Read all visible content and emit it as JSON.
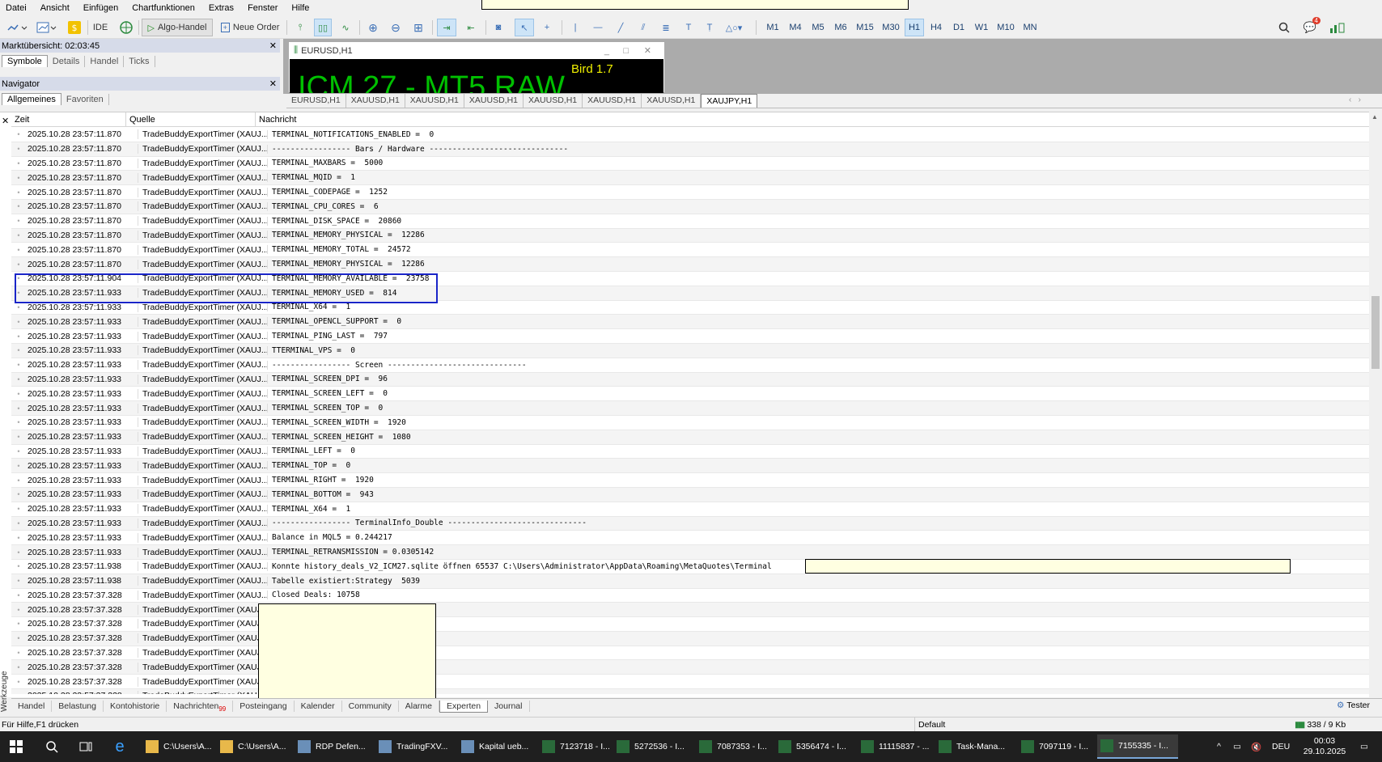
{
  "menu": [
    "Datei",
    "Ansicht",
    "Einfügen",
    "Chartfunktionen",
    "Extras",
    "Fenster",
    "Hilfe"
  ],
  "toolbar": {
    "ide_label": "IDE",
    "algo_label": "Algo-Handel",
    "order_label": "Neue Order",
    "timeframes": [
      "M1",
      "M4",
      "M5",
      "M6",
      "M15",
      "M30",
      "H1",
      "H4",
      "D1",
      "W1",
      "M10",
      "MN"
    ],
    "active_timeframe": "H1",
    "notification_count": "4"
  },
  "market_watch": {
    "title": "Marktübersicht: 02:03:45",
    "tabs": [
      "Symbole",
      "Details",
      "Handel",
      "Ticks"
    ]
  },
  "navigator": {
    "title": "Navigator",
    "tabs": [
      "Allgemeines",
      "Favoriten"
    ]
  },
  "chart_window": {
    "title": "EURUSD,H1",
    "big_text": "ICM 27 - MT5 RAW",
    "overlay_text": "Bird 1.7"
  },
  "chart_tabs": [
    "EURUSD,H1",
    "XAUUSD,H1",
    "XAUUSD,H1",
    "XAUUSD,H1",
    "XAUUSD,H1",
    "XAUUSD,H1",
    "XAUUSD,H1",
    "XAUJPY,H1"
  ],
  "log": {
    "columns": [
      "Zeit",
      "Quelle",
      "Nachricht"
    ],
    "rows": [
      {
        "time": "2025.10.28 23:57:11.870",
        "source": "TradeBuddyExportTimer (XAUJ...",
        "msg": "TERMINAL_NOTIFICATIONS_ENABLED =  0"
      },
      {
        "time": "2025.10.28 23:57:11.870",
        "source": "TradeBuddyExportTimer (XAUJ...",
        "msg": "----------------- Bars / Hardware ------------------------------"
      },
      {
        "time": "2025.10.28 23:57:11.870",
        "source": "TradeBuddyExportTimer (XAUJ...",
        "msg": "TERMINAL_MAXBARS =  5000"
      },
      {
        "time": "2025.10.28 23:57:11.870",
        "source": "TradeBuddyExportTimer (XAUJ...",
        "msg": "TERMINAL_MQID =  1"
      },
      {
        "time": "2025.10.28 23:57:11.870",
        "source": "TradeBuddyExportTimer (XAUJ...",
        "msg": "TERMINAL_CODEPAGE =  1252"
      },
      {
        "time": "2025.10.28 23:57:11.870",
        "source": "TradeBuddyExportTimer (XAUJ...",
        "msg": "TERMINAL_CPU_CORES =  6"
      },
      {
        "time": "2025.10.28 23:57:11.870",
        "source": "TradeBuddyExportTimer (XAUJ...",
        "msg": "TERMINAL_DISK_SPACE =  20860"
      },
      {
        "time": "2025.10.28 23:57:11.870",
        "source": "TradeBuddyExportTimer (XAUJ...",
        "msg": "TERMINAL_MEMORY_PHYSICAL =  12286"
      },
      {
        "time": "2025.10.28 23:57:11.870",
        "source": "TradeBuddyExportTimer (XAUJ...",
        "msg": "TERMINAL_MEMORY_TOTAL =  24572"
      },
      {
        "time": "2025.10.28 23:57:11.870",
        "source": "TradeBuddyExportTimer (XAUJ...",
        "msg": "TERMINAL_MEMORY_PHYSICAL =  12286"
      },
      {
        "time": "2025.10.28 23:57:11.904",
        "source": "TradeBuddyExportTimer (XAUJ...",
        "msg": "TERMINAL_MEMORY_AVAILABLE =  23758"
      },
      {
        "time": "2025.10.28 23:57:11.933",
        "source": "TradeBuddyExportTimer (XAUJ...",
        "msg": "TERMINAL_MEMORY_USED =  814"
      },
      {
        "time": "2025.10.28 23:57:11.933",
        "source": "TradeBuddyExportTimer (XAUJ...",
        "msg": "TERMINAL_X64 =  1"
      },
      {
        "time": "2025.10.28 23:57:11.933",
        "source": "TradeBuddyExportTimer (XAUJ...",
        "msg": "TERMINAL_OPENCL_SUPPORT =  0"
      },
      {
        "time": "2025.10.28 23:57:11.933",
        "source": "TradeBuddyExportTimer (XAUJ...",
        "msg": "TERMINAL_PING_LAST =  797"
      },
      {
        "time": "2025.10.28 23:57:11.933",
        "source": "TradeBuddyExportTimer (XAUJ...",
        "msg": "TTERMINAL_VPS =  0"
      },
      {
        "time": "2025.10.28 23:57:11.933",
        "source": "TradeBuddyExportTimer (XAUJ...",
        "msg": "----------------- Screen ------------------------------"
      },
      {
        "time": "2025.10.28 23:57:11.933",
        "source": "TradeBuddyExportTimer (XAUJ...",
        "msg": "TERMINAL_SCREEN_DPI =  96"
      },
      {
        "time": "2025.10.28 23:57:11.933",
        "source": "TradeBuddyExportTimer (XAUJ...",
        "msg": "TERMINAL_SCREEN_LEFT =  0"
      },
      {
        "time": "2025.10.28 23:57:11.933",
        "source": "TradeBuddyExportTimer (XAUJ...",
        "msg": "TERMINAL_SCREEN_TOP =  0"
      },
      {
        "time": "2025.10.28 23:57:11.933",
        "source": "TradeBuddyExportTimer (XAUJ...",
        "msg": "TERMINAL_SCREEN_WIDTH =  1920"
      },
      {
        "time": "2025.10.28 23:57:11.933",
        "source": "TradeBuddyExportTimer (XAUJ...",
        "msg": "TERMINAL_SCREEN_HEIGHT =  1080"
      },
      {
        "time": "2025.10.28 23:57:11.933",
        "source": "TradeBuddyExportTimer (XAUJ...",
        "msg": "TERMINAL_LEFT =  0"
      },
      {
        "time": "2025.10.28 23:57:11.933",
        "source": "TradeBuddyExportTimer (XAUJ...",
        "msg": "TERMINAL_TOP =  0"
      },
      {
        "time": "2025.10.28 23:57:11.933",
        "source": "TradeBuddyExportTimer (XAUJ...",
        "msg": "TERMINAL_RIGHT =  1920"
      },
      {
        "time": "2025.10.28 23:57:11.933",
        "source": "TradeBuddyExportTimer (XAUJ...",
        "msg": "TERMINAL_BOTTOM =  943"
      },
      {
        "time": "2025.10.28 23:57:11.933",
        "source": "TradeBuddyExportTimer (XAUJ...",
        "msg": "TERMINAL_X64 =  1"
      },
      {
        "time": "2025.10.28 23:57:11.933",
        "source": "TradeBuddyExportTimer (XAUJ...",
        "msg": "----------------- TerminalInfo_Double ------------------------------"
      },
      {
        "time": "2025.10.28 23:57:11.933",
        "source": "TradeBuddyExportTimer (XAUJ...",
        "msg": "Balance in MQL5 = 0.244217"
      },
      {
        "time": "2025.10.28 23:57:11.933",
        "source": "TradeBuddyExportTimer (XAUJ...",
        "msg": "TERMINAL_RETRANSMISSION = 0.0305142"
      },
      {
        "time": "2025.10.28 23:57:11.938",
        "source": "TradeBuddyExportTimer (XAUJ...",
        "msg": "Konnte history_deals_V2_ICM27.sqlite öffnen 65537 C:\\Users\\Administrator\\AppData\\Roaming\\MetaQuotes\\Terminal"
      },
      {
        "time": "2025.10.28 23:57:11.938",
        "source": "TradeBuddyExportTimer (XAUJ...",
        "msg": "Tabelle existiert:Strategy  5039"
      },
      {
        "time": "2025.10.28 23:57:37.328",
        "source": "TradeBuddyExportTimer (XAUJ...",
        "msg": "Closed Deals: 10758"
      },
      {
        "time": "2025.10.28 23:57:37.328",
        "source": "TradeBuddyExportTimer (XAUJ...",
        "msg": ""
      },
      {
        "time": "2025.10.28 23:57:37.328",
        "source": "TradeBuddyExportTimer (XAUJ...",
        "msg": ""
      },
      {
        "time": "2025.10.28 23:57:37.328",
        "source": "TradeBuddyExportTimer (XAUJ...",
        "msg": ""
      },
      {
        "time": "2025.10.28 23:57:37.328",
        "source": "TradeBuddyExportTimer (XAUJ...",
        "msg": ""
      },
      {
        "time": "2025.10.28 23:57:37.328",
        "source": "TradeBuddyExportTimer (XAUJ...",
        "msg": ""
      },
      {
        "time": "2025.10.28 23:57:37.328",
        "source": "TradeBuddyExportTimer (XAUJ...",
        "msg": ""
      },
      {
        "time": "2025.10.28 23:57:37.328",
        "source": "TradeBuddyExportTimer (XAUJ...",
        "msg": ""
      }
    ]
  },
  "side_label": "Werkzeuge",
  "bottom_tabs": [
    {
      "label": "Handel"
    },
    {
      "label": "Belastung"
    },
    {
      "label": "Kontohistorie"
    },
    {
      "label": "Nachrichten",
      "badge": "99"
    },
    {
      "label": "Posteingang"
    },
    {
      "label": "Kalender"
    },
    {
      "label": "Community"
    },
    {
      "label": "Alarme"
    },
    {
      "label": "Experten",
      "selected": true
    },
    {
      "label": "Journal"
    }
  ],
  "tester_label": "Tester",
  "status": {
    "help": "Für Hilfe,F1 drücken",
    "profile": "Default",
    "traffic": "338 / 9 Kb"
  },
  "taskbar": {
    "items": [
      "C:\\Users\\A...",
      "C:\\Users\\A...",
      "RDP Defen...",
      "TradingFXV...",
      "Kapital ueb...",
      "7123718 - I...",
      "5272536 - I...",
      "7087353 - I...",
      "5356474 - I...",
      "11115837 - ...",
      "Task-Mana...",
      "7097119 - I...",
      "7155335 - I..."
    ],
    "lang": "DEU",
    "time": "00:03",
    "date": "29.10.2025"
  },
  "colors": {
    "highlight": "#1a25c8",
    "redact": "#ffffe1",
    "chart_text": "#00c000",
    "chart_overlay": "#f0f000"
  }
}
